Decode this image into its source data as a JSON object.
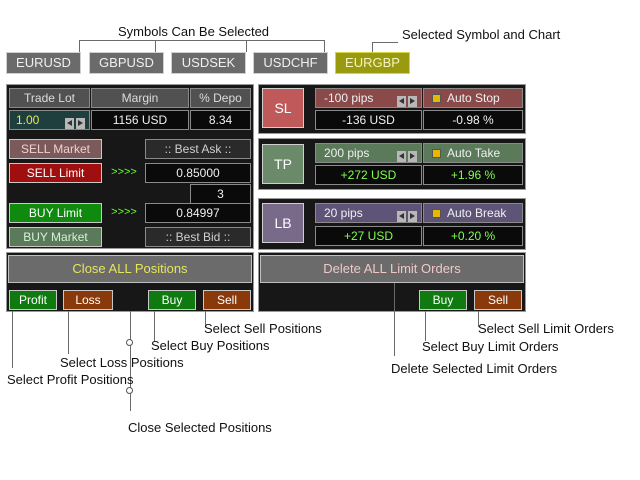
{
  "annotations": {
    "symbols_can_be_selected": "Symbols Can Be Selected",
    "selected_symbol_and_chart": "Selected Symbol and Chart",
    "select_sell_positions": "Select Sell Positions",
    "select_buy_positions": "Select Buy Positions",
    "select_loss_positions": "Select Loss Positions",
    "select_profit_positions": "Select Profit Positions",
    "close_selected_positions": "Close Selected Positions",
    "select_sell_limit_orders": "Select Sell Limit Orders",
    "select_buy_limit_orders": "Select Buy Limit Orders",
    "delete_selected_limit_orders": "Delete Selected Limit Orders"
  },
  "symbols": {
    "items": [
      "EURUSD",
      "GBPUSD",
      "USDSEK",
      "USDCHF"
    ],
    "selected": "EURGBP"
  },
  "trade": {
    "lot_header": "Trade Lot",
    "margin_header": "Margin",
    "depo_header": "% Depo",
    "lot_value": "1.00",
    "margin_value": "1156 USD",
    "depo_value": "8.34",
    "sell_market": "SELL Market",
    "best_ask": ":: Best Ask ::",
    "sell_limit": "SELL Limit",
    "sell_arrows": ">>>>",
    "sell_limit_price": "0.85000",
    "spread": "3",
    "buy_limit": "BUY Limit",
    "buy_arrows": ">>>>",
    "buy_limit_price": "0.84997",
    "buy_market": "BUY Market",
    "best_bid": ":: Best Bid ::"
  },
  "positions": {
    "close_all": "Close ALL Positions",
    "profit": "Profit",
    "loss": "Loss",
    "buy": "Buy",
    "sell": "Sell"
  },
  "risk": {
    "sl": {
      "label": "SL",
      "pips": "-100 pips",
      "auto": "Auto Stop",
      "usd": "-136 USD",
      "pct": "-0.98 %"
    },
    "tp": {
      "label": "TP",
      "pips": "200 pips",
      "auto": "Auto Take",
      "usd": "+272 USD",
      "pct": "+1.96 %"
    },
    "lb": {
      "label": "LB",
      "pips": "20 pips",
      "auto": "Auto Break",
      "usd": "+27 USD",
      "pct": "+0.20 %"
    }
  },
  "orders": {
    "delete_all": "Delete ALL Limit Orders",
    "buy": "Buy",
    "sell": "Sell"
  },
  "colors": {
    "selected_symbol": "#9a9a10",
    "sell": "#a00f0f",
    "buy": "#0f8a0f",
    "profit_green": "#7fff4c",
    "close_all_text": "#e6e65a"
  }
}
